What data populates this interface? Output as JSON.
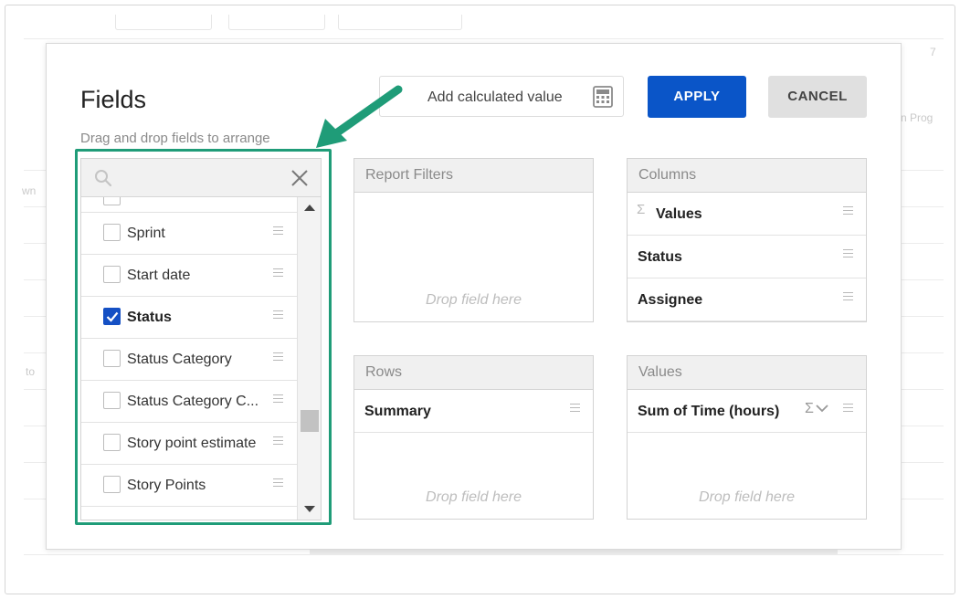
{
  "background": {
    "fragments": [
      "7",
      "n Prog",
      "wn",
      "to"
    ]
  },
  "dialog": {
    "title": "Fields",
    "subtitle": "Drag and drop fields to arrange",
    "calc_button_label": "Add calculated value",
    "apply_label": "APPLY",
    "cancel_label": "CANCEL"
  },
  "fields": {
    "search_placeholder": "",
    "items": [
      {
        "label": "",
        "checked": false
      },
      {
        "label": "Sprint",
        "checked": false
      },
      {
        "label": "Start date",
        "checked": false
      },
      {
        "label": "Status",
        "checked": true
      },
      {
        "label": "Status Category",
        "checked": false
      },
      {
        "label": "Status Category C...",
        "checked": false
      },
      {
        "label": "Story point estimate",
        "checked": false
      },
      {
        "label": "Story Points",
        "checked": false
      }
    ]
  },
  "zones": {
    "report_filters": {
      "title": "Report Filters",
      "drop_hint": "Drop field here"
    },
    "columns": {
      "title": "Columns",
      "items": [
        "Values",
        "Status",
        "Assignee"
      ]
    },
    "rows": {
      "title": "Rows",
      "items": [
        "Summary"
      ],
      "drop_hint": "Drop field here"
    },
    "values": {
      "title": "Values",
      "items": [
        "Sum of Time (hours)"
      ],
      "drop_hint": "Drop field here"
    }
  },
  "colors": {
    "apply": "#0a55c8",
    "checkbox_checked": "#1550c4",
    "annotation": "#1f9c78"
  }
}
